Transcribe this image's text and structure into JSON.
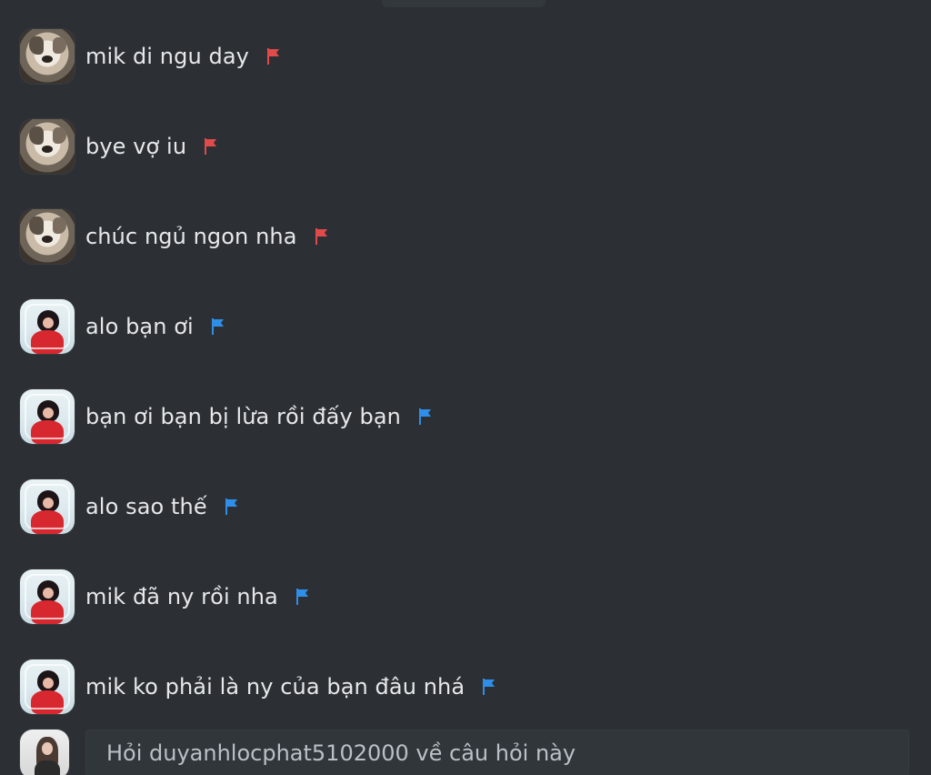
{
  "messages": [
    {
      "text": "mik di ngu day",
      "flag_color": "#e04a4a",
      "avatar": "dog-avatar"
    },
    {
      "text": "bye vợ iu",
      "flag_color": "#e04a4a",
      "avatar": "dog-avatar"
    },
    {
      "text": "chúc ngủ ngon nha",
      "flag_color": "#e04a4a",
      "avatar": "dog-avatar"
    },
    {
      "text": "alo bạn ơi",
      "flag_color": "#2f8ee8",
      "avatar": "girl-avatar"
    },
    {
      "text": "bạn ơi bạn bị lừa rồi đấy bạn",
      "flag_color": "#2f8ee8",
      "avatar": "girl-avatar"
    },
    {
      "text": "alo sao thế",
      "flag_color": "#2f8ee8",
      "avatar": "girl-avatar"
    },
    {
      "text": "mik đã ny rồi nha",
      "flag_color": "#2f8ee8",
      "avatar": "girl-avatar"
    },
    {
      "text": "mik ko phải là ny của bạn đâu nhá",
      "flag_color": "#2f8ee8",
      "avatar": "girl-avatar"
    }
  ],
  "composer": {
    "placeholder": "Hỏi duyanhlocphat5102000 về câu hỏi này"
  },
  "colors": {
    "background": "#2c3034",
    "text": "#e6e8ea",
    "input_bg": "#31363b",
    "report_red": "#e04a4a",
    "report_blue": "#2f8ee8"
  }
}
